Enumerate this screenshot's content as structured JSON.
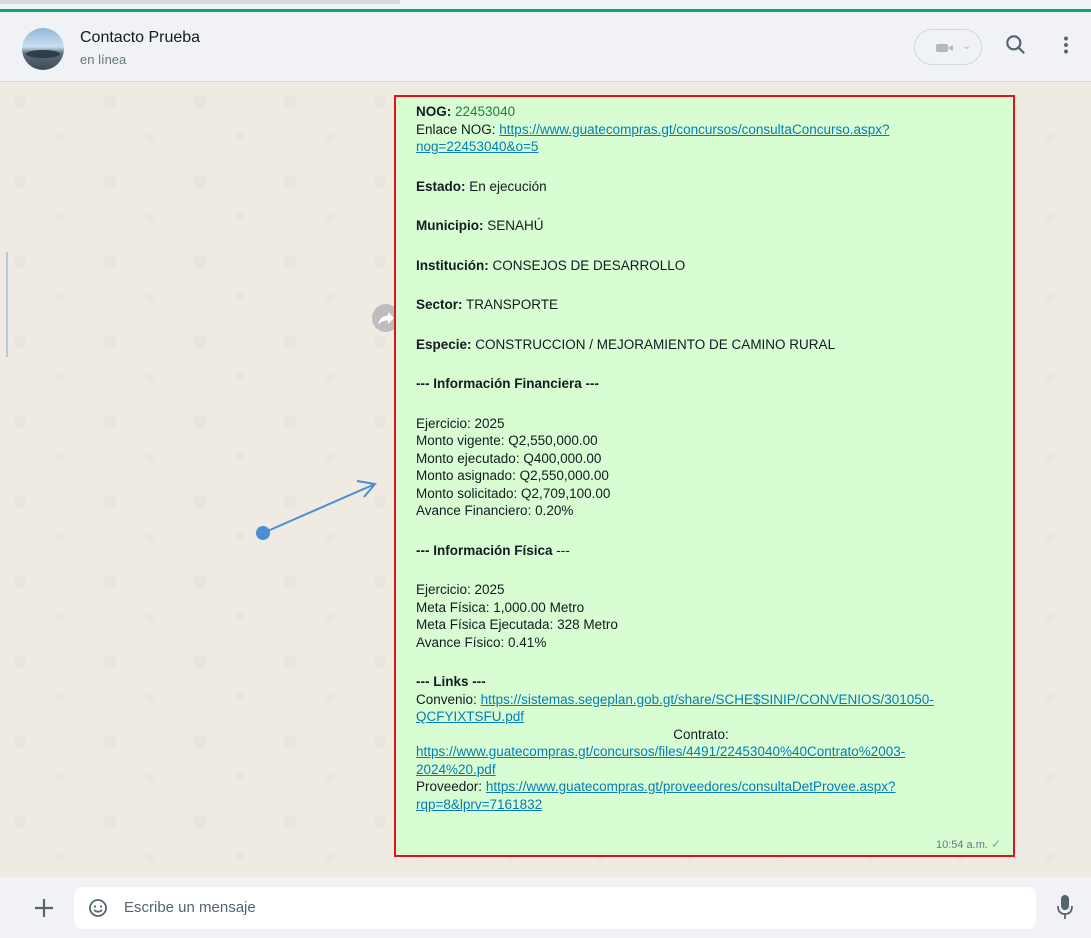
{
  "header": {
    "contact_name": "Contacto Prueba",
    "status": "en línea",
    "icons": [
      "avatar",
      "video-call-icon",
      "search-icon",
      "menu-icon"
    ]
  },
  "message": {
    "nog_label": "NOG:",
    "nog_value": "22453040",
    "enlace_label": "Enlace NOG:",
    "enlace_url_1": "https://www.guatecompras.gt/concursos/consultaConcurso.aspx?",
    "enlace_url_2": "nog=22453040&o=5",
    "estado_label": "Estado:",
    "estado_value": "En ejecución",
    "municipio_label": "Municipio:",
    "municipio_value": "SENAHÚ",
    "institucion_label": "Institución:",
    "institucion_value": "CONSEJOS DE DESARROLLO",
    "sector_label": "Sector:",
    "sector_value": "TRANSPORTE",
    "especie_label": "Especie:",
    "especie_value": "CONSTRUCCION / MEJORAMIENTO DE CAMINO RURAL",
    "fin_title": "--- Información Financiera ---",
    "fin_lines": [
      "Ejercicio: 2025",
      "Monto vigente: Q2,550,000.00",
      "Monto ejecutado: Q400,000.00",
      "Monto asignado: Q2,550,000.00",
      "Monto solicitado: Q2,709,100.00",
      "Avance Financiero: 0.20%"
    ],
    "fis_title_bold": "--- Información Física",
    "fis_title_rest": " ---",
    "fis_lines": [
      "Ejercicio: 2025",
      "Meta Física: 1,000.00 Metro",
      "Meta Física Ejecutada: 328 Metro",
      "Avance Físico: 0.41%"
    ],
    "links_title": "--- Links ---",
    "convenio_label": "Convenio:",
    "convenio_url_1": "https://sistemas.segeplan.gob.gt/share/SCHE$SINIP/CONVENIOS/301050-",
    "convenio_url_2": "QCFYIXTSFU.pdf",
    "contrato_label": "Contrato:",
    "contrato_url_1": "https://www.guatecompras.gt/concursos/files/4491/22453040%40Contrato%2003-",
    "contrato_url_2": "2024%20.pdf",
    "proveedor_label": "Proveedor:",
    "proveedor_url_1": "https://www.guatecompras.gt/proveedores/consultaDetProvee.aspx?",
    "proveedor_url_2": "rqp=8&lprv=7161832",
    "time": "10:54 a.m."
  },
  "footer": {
    "placeholder": "Escribe un mensaje"
  },
  "colors": {
    "bubble": "#d9fdd3",
    "annotation_box": "#e3111b",
    "annotation_arrow": "#4a8fd6",
    "link": "#027eb5",
    "accent": "#00a884"
  }
}
